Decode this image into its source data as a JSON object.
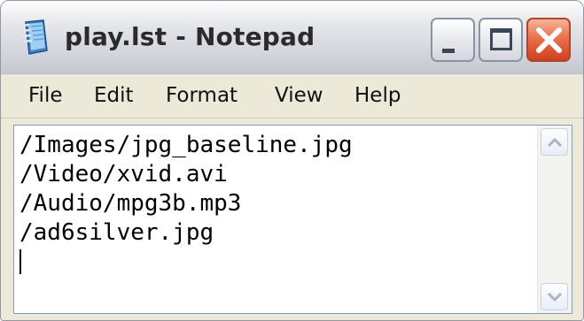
{
  "window": {
    "title": "play.lst - Notepad"
  },
  "menu": {
    "items": [
      {
        "label": "File"
      },
      {
        "label": "Edit"
      },
      {
        "label": "Format"
      },
      {
        "label": "View"
      },
      {
        "label": "Help"
      }
    ]
  },
  "editor": {
    "lines": [
      "/Images/jpg_baseline.jpg",
      "/Video/xvid.avi",
      "/Audio/mpg3b.mp3",
      "/ad6silver.jpg"
    ]
  },
  "colors": {
    "close_button": "#d0401f",
    "editor_border": "#7f9db9",
    "menubar_bg": "#ece9d8"
  }
}
